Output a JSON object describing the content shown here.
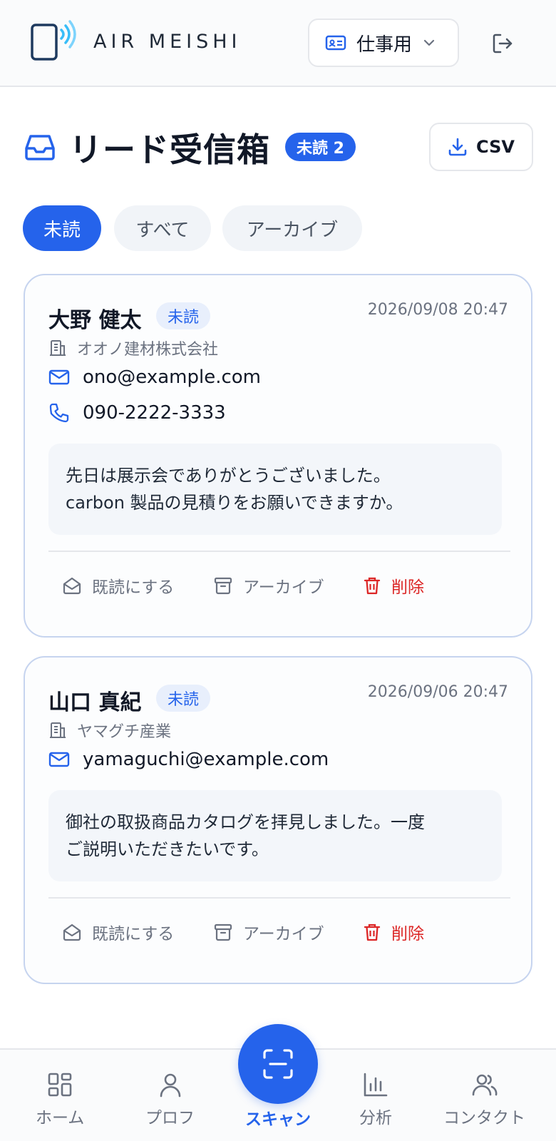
{
  "header": {
    "app_name": "AIR MEISHI",
    "profile_label": "仕事用"
  },
  "page": {
    "title": "リード受信箱",
    "unread_badge": "未読 2",
    "csv_label": "CSV"
  },
  "tabs": [
    {
      "label": "未読",
      "active": true
    },
    {
      "label": "すべて",
      "active": false
    },
    {
      "label": "アーカイブ",
      "active": false
    }
  ],
  "leads": [
    {
      "name": "大野 健太",
      "status": "未読",
      "date": "2026/09/08 20:47",
      "company": "オオノ建材株式会社",
      "email": "ono@example.com",
      "phone": "090-2222-3333",
      "message_line1": "先日は展示会でありがとうございました。",
      "message_line2": "carbon 製品の見積りをお願いできますか。"
    },
    {
      "name": "山口 真紀",
      "status": "未読",
      "date": "2026/09/06 20:47",
      "company": "ヤマグチ産業",
      "email": "yamaguchi@example.com",
      "message_line1": "御社の取扱商品カタログを拝見しました。一度",
      "message_line2": "ご説明いただきたいです。"
    }
  ],
  "actions": {
    "mark_read": "既読にする",
    "archive": "アーカイブ",
    "delete": "削除"
  },
  "nav": {
    "home": "ホーム",
    "profile": "プロフ",
    "scan": "スキャン",
    "analytics": "分析",
    "contacts": "コンタクト"
  },
  "colors": {
    "accent": "#2563eb",
    "danger": "#dc2626",
    "muted": "#6b7280"
  }
}
